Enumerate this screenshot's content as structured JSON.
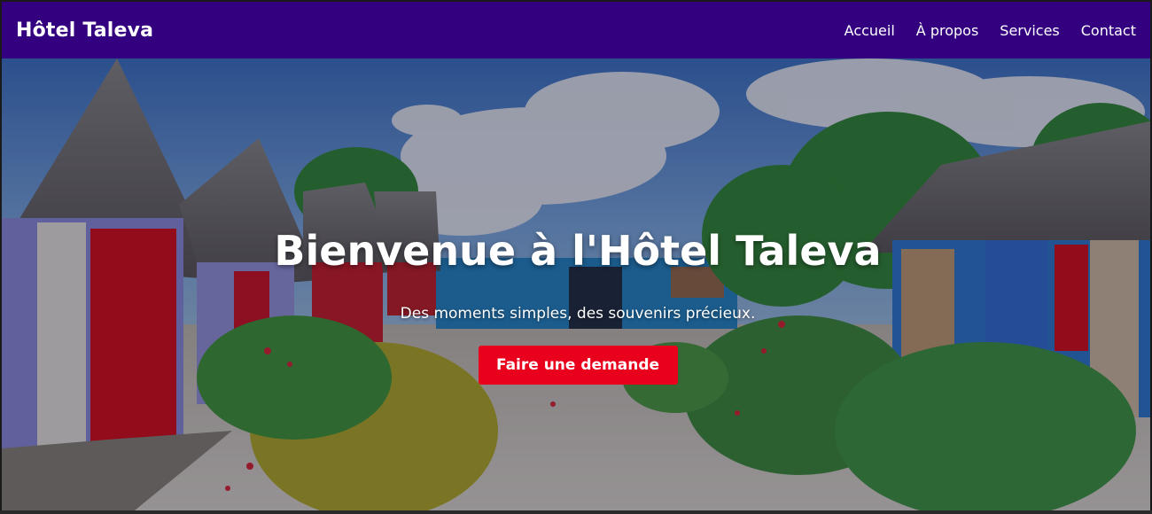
{
  "header": {
    "brand": "Hôtel Taleva",
    "nav": [
      {
        "label": "Accueil"
      },
      {
        "label": "À propos"
      },
      {
        "label": "Services"
      },
      {
        "label": "Contact"
      }
    ]
  },
  "hero": {
    "title": "Bienvenue à l'Hôtel Taleva",
    "subtitle": "Des moments simples, des souvenirs précieux.",
    "cta_label": "Faire une demande",
    "background_image": "photo-bungalows-thatched-roofs-tropical-garden"
  },
  "colors": {
    "navbar": "#330080",
    "cta": "#e8001c",
    "text": "#ffffff"
  }
}
